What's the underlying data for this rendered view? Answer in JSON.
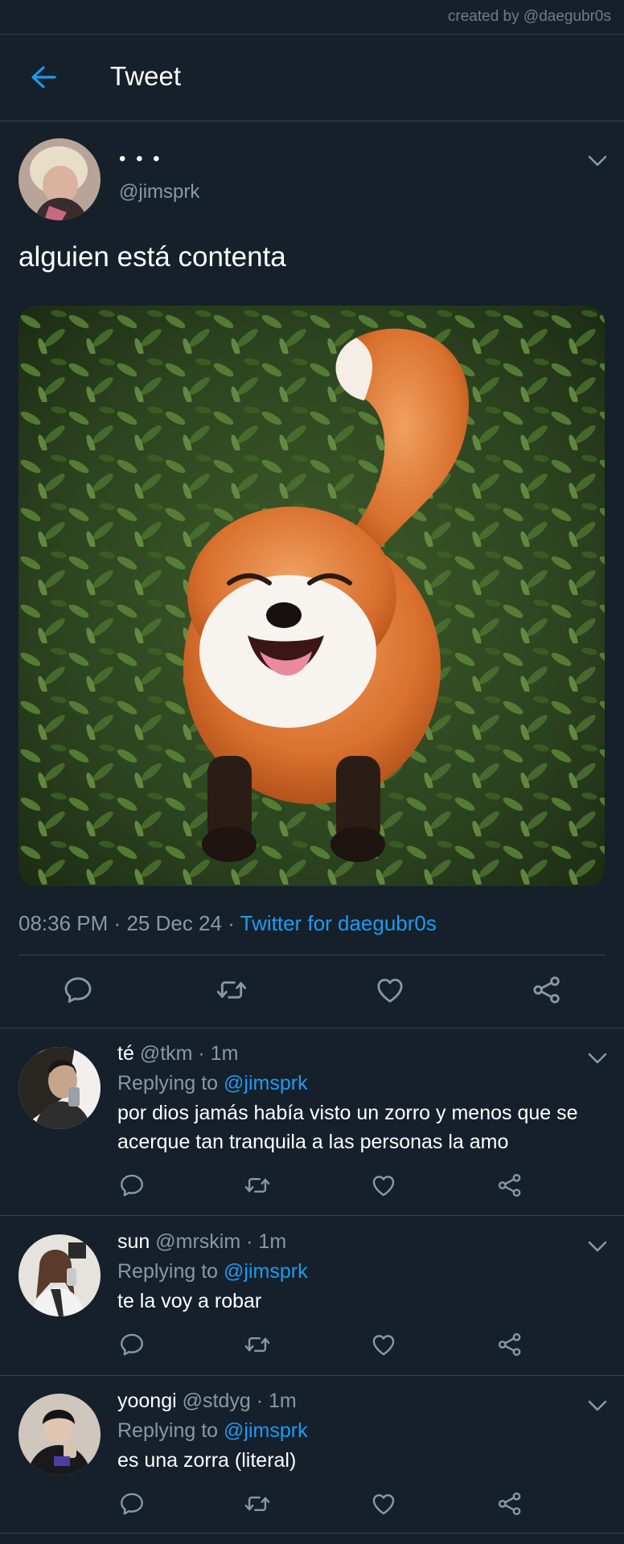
{
  "credit": "created by @daegubr0s",
  "header": {
    "title": "Tweet"
  },
  "tweet": {
    "name": "• • •",
    "handle": "@jimsprk",
    "text": "alguien está contenta",
    "time": "08:36 PM",
    "dot": "·",
    "date": "25 Dec 24",
    "source": "Twitter for daegubr0s"
  },
  "replies": [
    {
      "name": "té",
      "handle": "@tkm",
      "time": "1m",
      "replying_label": "Replying to",
      "replying_to": "@jimsprk",
      "text": "por dios jamás había visto un zorro y menos que se acerque tan tranquila a las personas la amo"
    },
    {
      "name": "sun",
      "handle": "@mrskim",
      "time": "1m",
      "replying_label": "Replying to",
      "replying_to": "@jimsprk",
      "text": "te la voy a robar"
    },
    {
      "name": "yoongi",
      "handle": "@stdyg",
      "time": "1m",
      "replying_label": "Replying to",
      "replying_to": "@jimsprk",
      "text": "es una zorra (literal)"
    }
  ],
  "icons": {
    "back": "arrow-left-icon",
    "more": "chevron-down-icon",
    "reply": "speech-bubble-icon",
    "retweet": "retweet-icon",
    "like": "heart-icon",
    "share": "share-icon"
  },
  "colors": {
    "background": "#15202b",
    "accent": "#1d9bf0",
    "muted": "#8899a6",
    "divider": "#38444d"
  }
}
